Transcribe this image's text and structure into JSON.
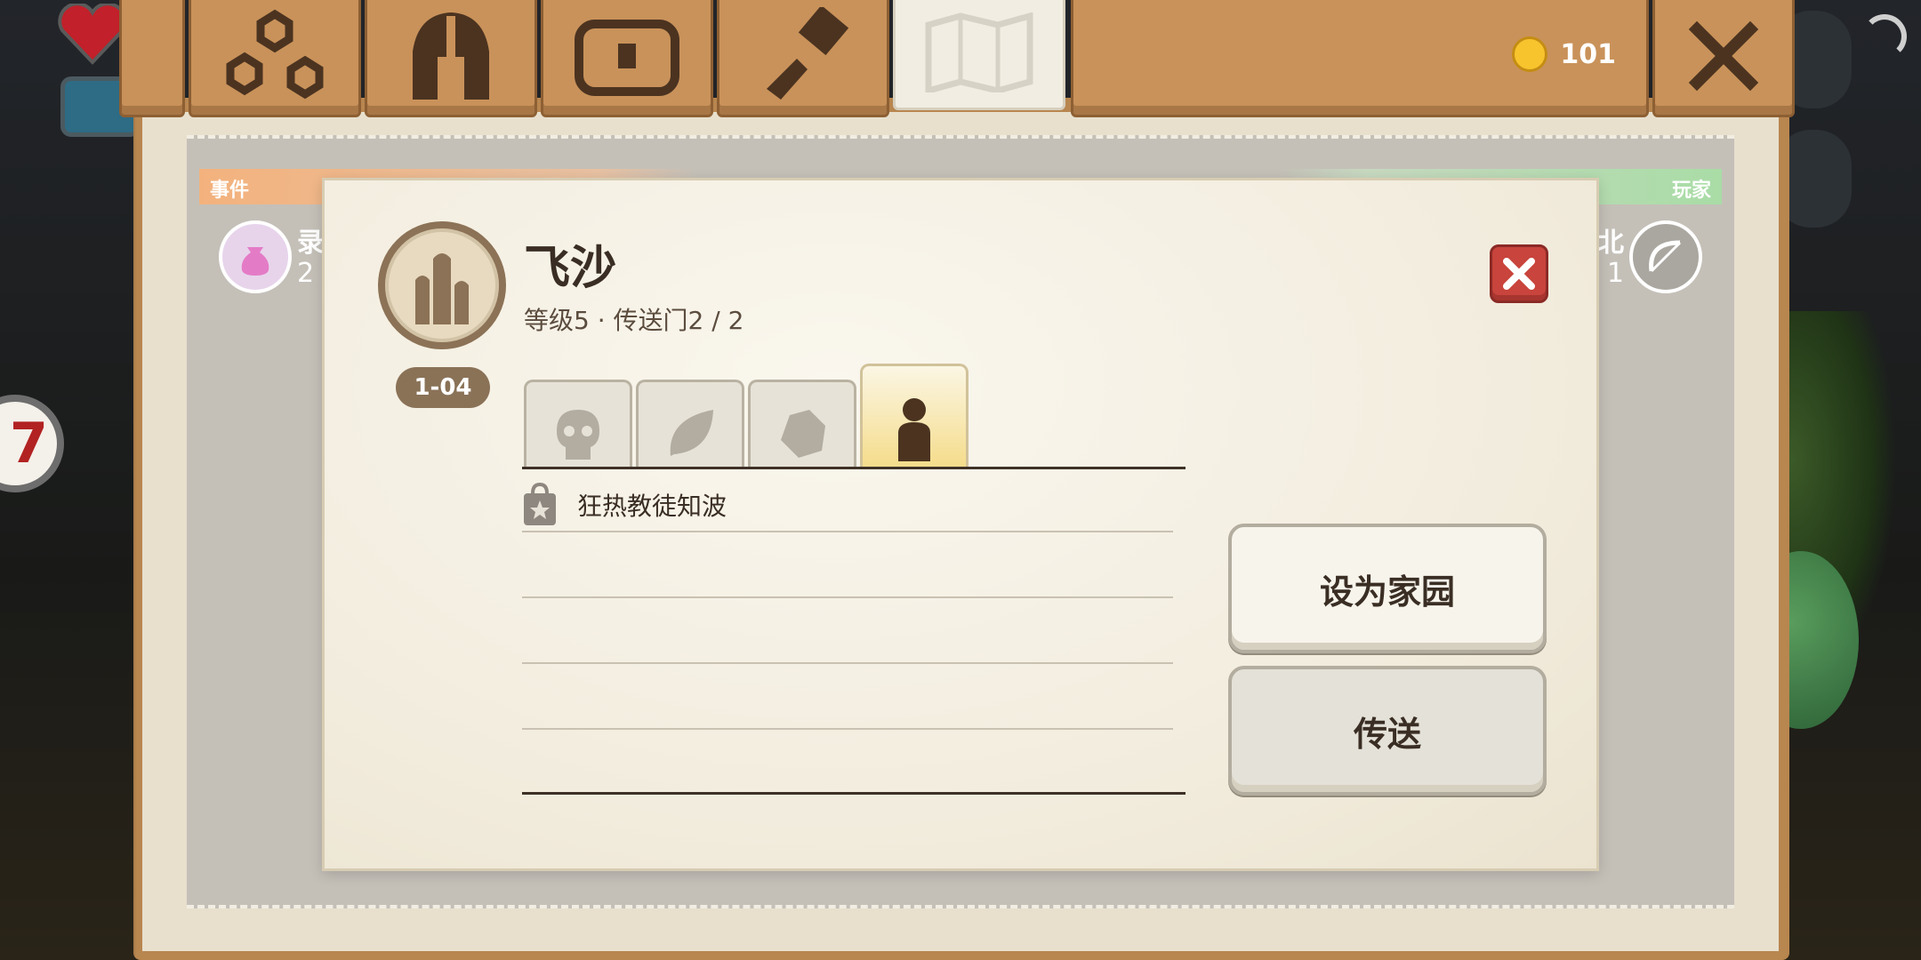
{
  "topbar": {
    "coins": "101",
    "tabs": [
      "family-tree-icon",
      "helmet-icon",
      "chest-icon",
      "hammer-icon",
      "map-icon"
    ]
  },
  "background_map": {
    "left_label": "事件",
    "right_label": "玩家",
    "left_peek_text": "录",
    "left_peek_num": "2",
    "right_peek_text": "北",
    "right_peek_num": "1"
  },
  "location": {
    "name": "飞沙",
    "info": "等级5 · 传送门2 / 2",
    "badge": "1-04"
  },
  "category_tabs": [
    {
      "icon": "skull-icon"
    },
    {
      "icon": "leaf-icon"
    },
    {
      "icon": "rock-icon"
    },
    {
      "icon": "person-icon"
    }
  ],
  "list": [
    {
      "text": "狂热教徒知波",
      "icon": "bag-star-icon"
    }
  ],
  "buttons": {
    "set_home": "设为家园",
    "teleport": "传送"
  },
  "colors": {
    "wood": "#c9925a",
    "parchment": "#f1ebdc",
    "accent_gold": "#f5dc8a",
    "close_red": "#c8443c",
    "coin": "#f7c42e"
  }
}
